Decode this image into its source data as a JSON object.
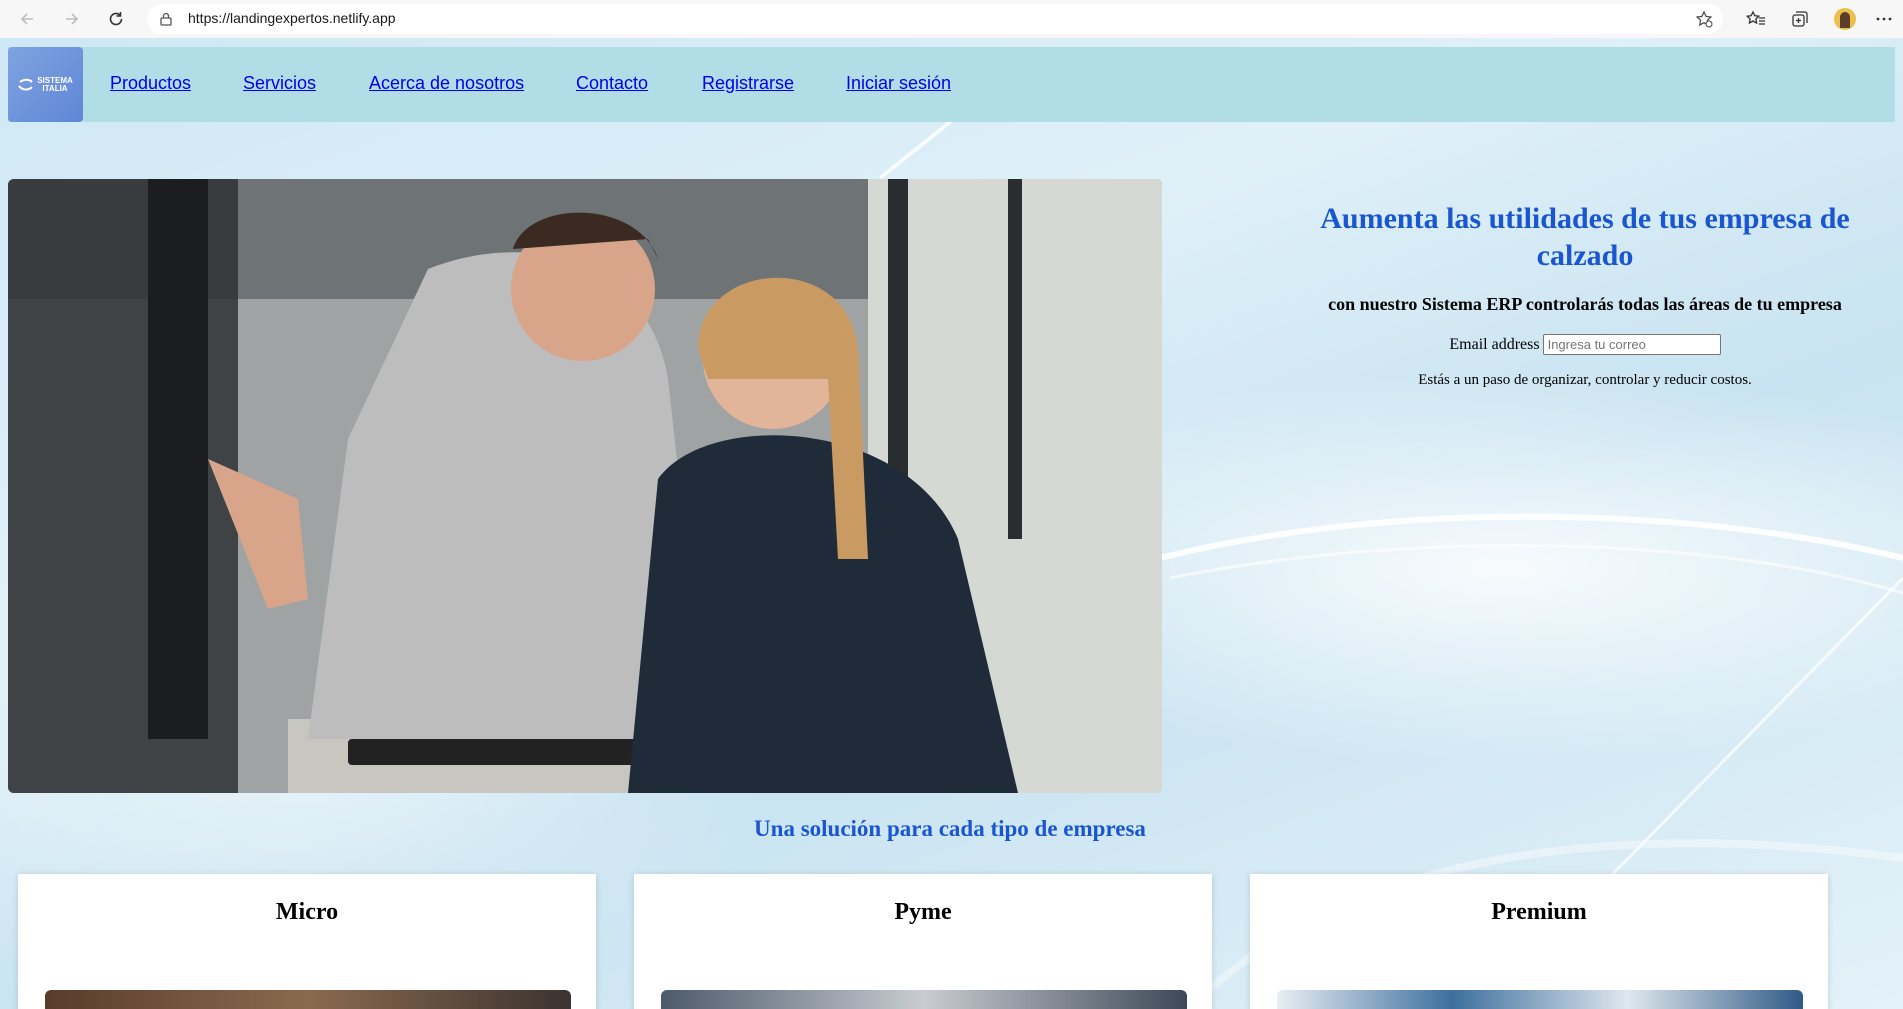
{
  "browser": {
    "url": "https://landingexpertos.netlify.app",
    "icons": [
      "back-icon",
      "forward-icon",
      "refresh-icon",
      "lock-icon",
      "add-favorite-icon",
      "favorites-icon",
      "collections-icon",
      "profile-avatar",
      "more-icon"
    ]
  },
  "navbar": {
    "logo_line1": "SISTEMA",
    "logo_line2": "ITALIA",
    "links": [
      {
        "label": "Productos"
      },
      {
        "label": "Servicios"
      },
      {
        "label": "Acerca de nosotros"
      },
      {
        "label": "Contacto"
      },
      {
        "label": "Registrarse"
      },
      {
        "label": "Iniciar sesión"
      }
    ]
  },
  "hero": {
    "title": "Aumenta las utilidades de tus empresa de calzado",
    "subtitle": "con nuestro Sistema ERP controlarás todas las áreas de tu empresa",
    "email_label": "Email address",
    "email_placeholder": "Ingresa tu correo",
    "email_value": "",
    "note": "Estás a un paso de organizar, controlar y reducir costos."
  },
  "solutions": {
    "title": "Una solución para cada tipo de empresa",
    "cards": [
      {
        "title": "Micro"
      },
      {
        "title": "Pyme"
      },
      {
        "title": "Premium"
      }
    ]
  },
  "colors": {
    "accent_blue": "#1a56cf",
    "navbar_bg": "#b0dde6",
    "link": "#0000ee"
  }
}
